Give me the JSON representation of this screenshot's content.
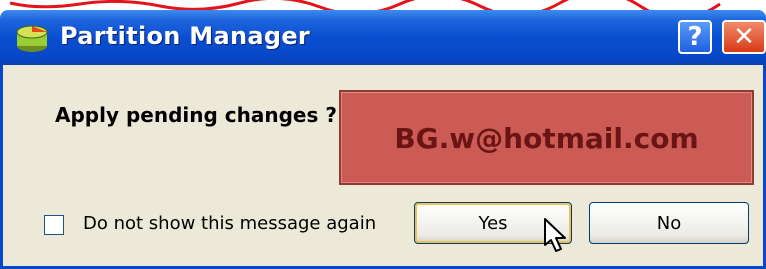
{
  "window": {
    "title": "Partition Manager",
    "help_glyph": "?",
    "close_glyph": "✕"
  },
  "dialog": {
    "message": "Apply pending changes ?",
    "checkbox_label": "Do not show this message again",
    "checkbox_checked": false,
    "yes_label": "Yes",
    "no_label": "No"
  },
  "watermark": {
    "text": "BG.w@hotmail.com"
  },
  "colors": {
    "titlebar": "#0747c8",
    "client_bg": "#ece9d8",
    "watermark_bg": "#cc5b55",
    "watermark_text": "#6a1414"
  },
  "icons": [
    "partition-manager-icon",
    "help-icon",
    "close-icon",
    "mouse-pointer-icon"
  ]
}
